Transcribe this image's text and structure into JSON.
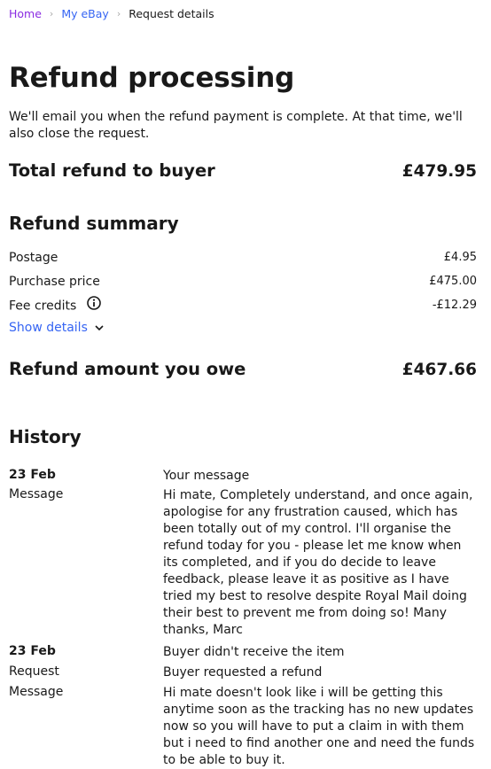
{
  "breadcrumb": {
    "home": "Home",
    "my_ebay": "My eBay",
    "current": "Request details"
  },
  "page": {
    "title": "Refund processing",
    "notice": "We'll email you when the refund payment is complete. At that time, we'll also close the request."
  },
  "total_refund": {
    "label": "Total refund to buyer",
    "value": "£479.95"
  },
  "refund_summary": {
    "heading": "Refund summary",
    "postage_label": "Postage",
    "postage_value": "£4.95",
    "purchase_label": "Purchase price",
    "purchase_value": "£475.00",
    "fee_label": "Fee credits",
    "fee_value": "-£12.29",
    "show_details": "Show details"
  },
  "refund_owe": {
    "label": "Refund amount you owe",
    "value": "£467.66"
  },
  "history": {
    "heading": "History",
    "entry1": {
      "date": "23 Feb",
      "title": "Your message",
      "message_label": "Message",
      "message": "Hi mate, Completely understand, and once again, apologise for any frustration caused, which has been totally out of my control. I'll organise the refund today for you - please let me know when its completed, and if you do decide to leave feedback, please leave it as positive as I have tried my best to resolve despite Royal Mail doing their best to prevent me from doing so! Many thanks, Marc"
    },
    "entry2": {
      "date": "23 Feb",
      "title": "Buyer didn't receive the item",
      "request_label": "Request",
      "request": "Buyer requested a refund",
      "message_label": "Message",
      "message": "Hi mate doesn't look like i will be getting this anytime soon as the tracking has no new updates now so you will have to put a claim in with them but i need to find another one and need the funds to be able to buy it."
    }
  },
  "icons": {
    "info": "info-circle-icon",
    "chevron": "chevron-down-icon"
  }
}
